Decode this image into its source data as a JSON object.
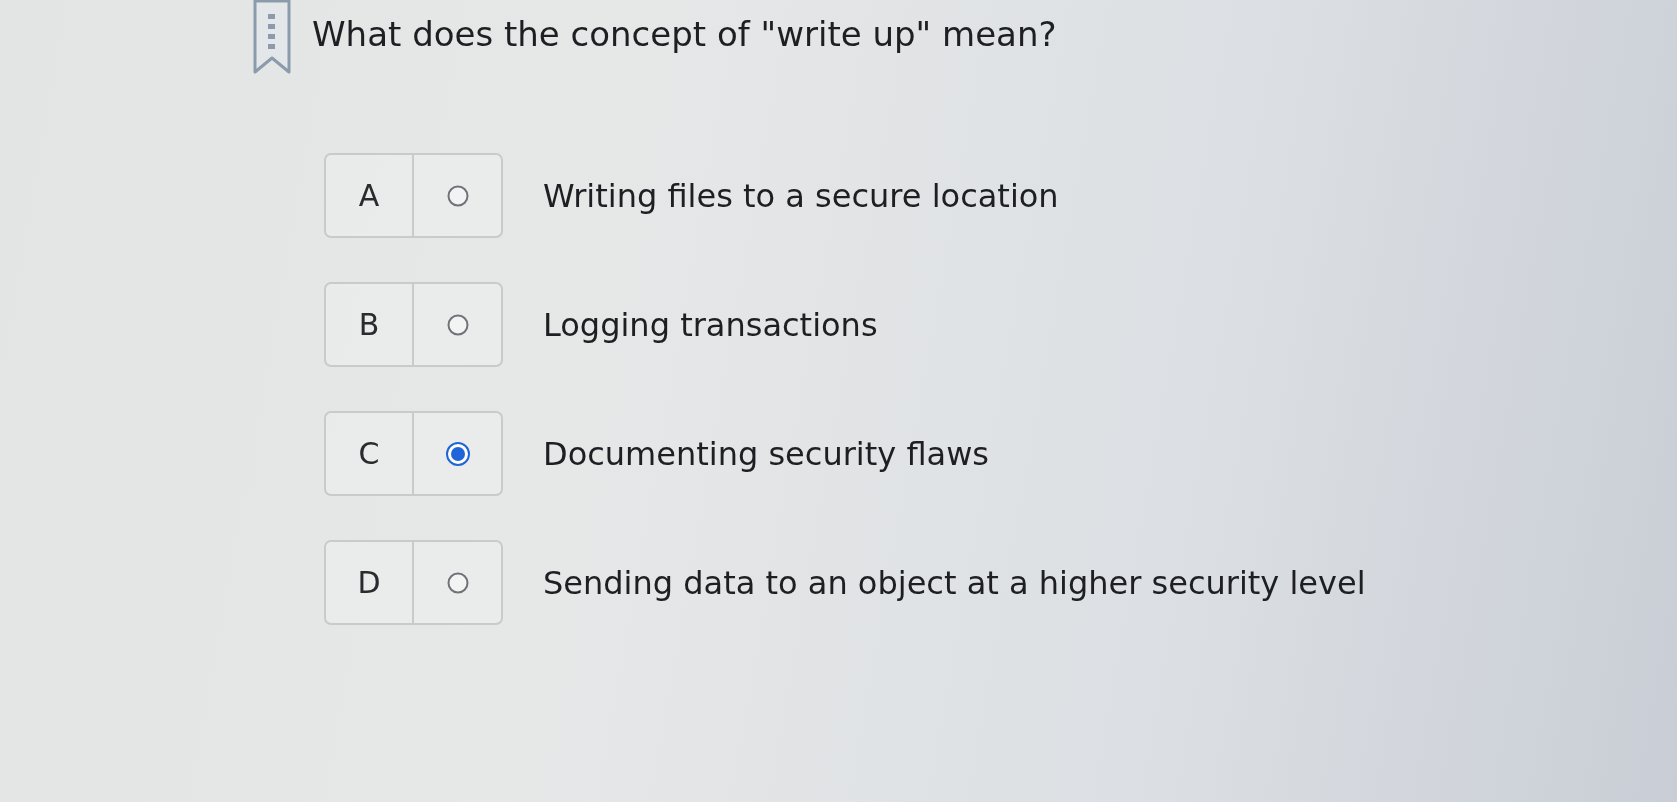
{
  "question": {
    "text": "What does the concept of \"write up\" mean?"
  },
  "options": [
    {
      "letter": "A",
      "text": "Writing files to a secure location",
      "selected": false
    },
    {
      "letter": "B",
      "text": "Logging transactions",
      "selected": false
    },
    {
      "letter": "C",
      "text": "Documenting security flaws",
      "selected": true
    },
    {
      "letter": "D",
      "text": "Sending data to an object at a higher security level",
      "selected": false
    }
  ]
}
